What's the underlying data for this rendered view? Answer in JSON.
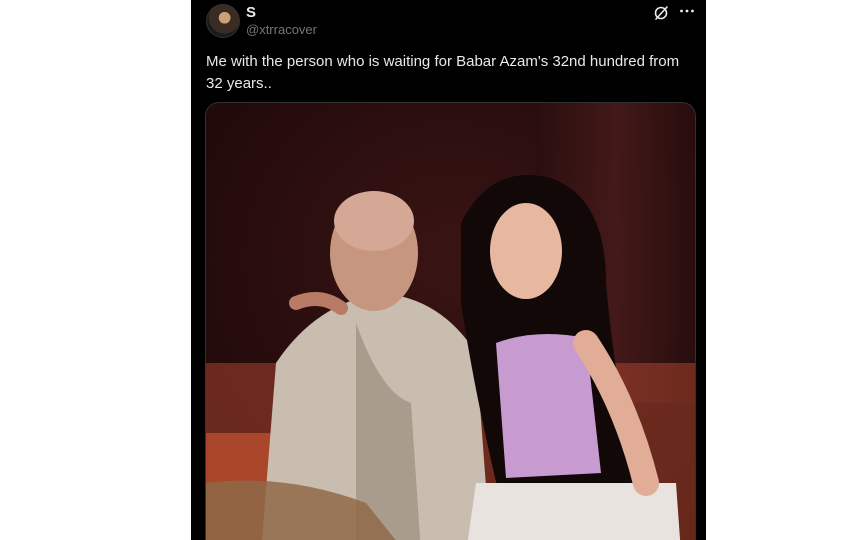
{
  "tweet": {
    "author": {
      "display_name": "S",
      "handle": "@xtrracover",
      "avatar_icon": "profile-avatar"
    },
    "actions": {
      "grok_icon": "grok-icon",
      "more_icon": "more-options-icon"
    },
    "text": "Me with the person who is waiting for Babar Azam's 32nd hundred from 32 years..",
    "media": {
      "type": "photo"
    }
  },
  "colors": {
    "background": "#000000",
    "text_primary": "#e7e9ea",
    "text_secondary": "#71767b",
    "page_background": "#ffffff"
  }
}
